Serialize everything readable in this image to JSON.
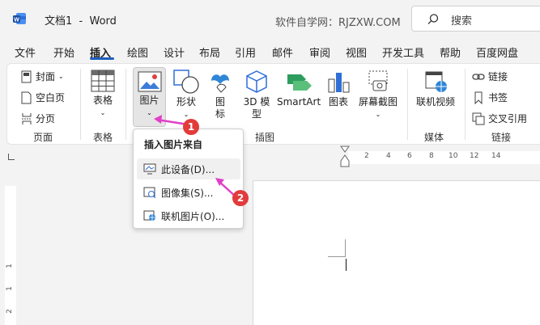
{
  "titlebar": {
    "app_title": "文档1  -  Word",
    "site": "软件自学网：RJZXW.COM",
    "search_placeholder": "搜索"
  },
  "tabs": [
    {
      "label": "文件"
    },
    {
      "label": "开始"
    },
    {
      "label": "插入",
      "active": true
    },
    {
      "label": "绘图"
    },
    {
      "label": "设计"
    },
    {
      "label": "布局"
    },
    {
      "label": "引用"
    },
    {
      "label": "邮件"
    },
    {
      "label": "审阅"
    },
    {
      "label": "视图"
    },
    {
      "label": "开发工具"
    },
    {
      "label": "帮助"
    },
    {
      "label": "百度网盘"
    }
  ],
  "ribbon": {
    "pages": {
      "cover": "封面",
      "blank": "空白页",
      "break": "分页",
      "group": "页面"
    },
    "tables": {
      "table": "表格",
      "group": "表格"
    },
    "illustrations": {
      "picture": "图片",
      "shapes": "形状",
      "icons_1": "图",
      "icons_2": "标",
      "model_1": "3D 模",
      "model_2": "型",
      "smartart": "SmartArt",
      "chart": "图表",
      "screenshot": "屏幕截图",
      "group": "插图"
    },
    "media": {
      "video": "联机视频",
      "group": "媒体"
    },
    "links": {
      "link": "链接",
      "bookmark": "书签",
      "crossref": "交叉引用",
      "group": "链接"
    }
  },
  "dropdown": {
    "title": "插入图片来自",
    "items": [
      {
        "label": "此设备(D)..."
      },
      {
        "label": "图像集(S)..."
      },
      {
        "label": "联机图片(O)..."
      }
    ]
  },
  "badges": {
    "one": "1",
    "two": "2"
  },
  "ruler": {
    "h": [
      "2",
      "2",
      "4",
      "6",
      "8",
      "10",
      "12",
      "14"
    ],
    "v": [
      "1",
      "1",
      "2"
    ]
  },
  "colors": {
    "accent": "#1f5fbf",
    "badge": "#e23b3b",
    "arrow": "#e040c8"
  }
}
